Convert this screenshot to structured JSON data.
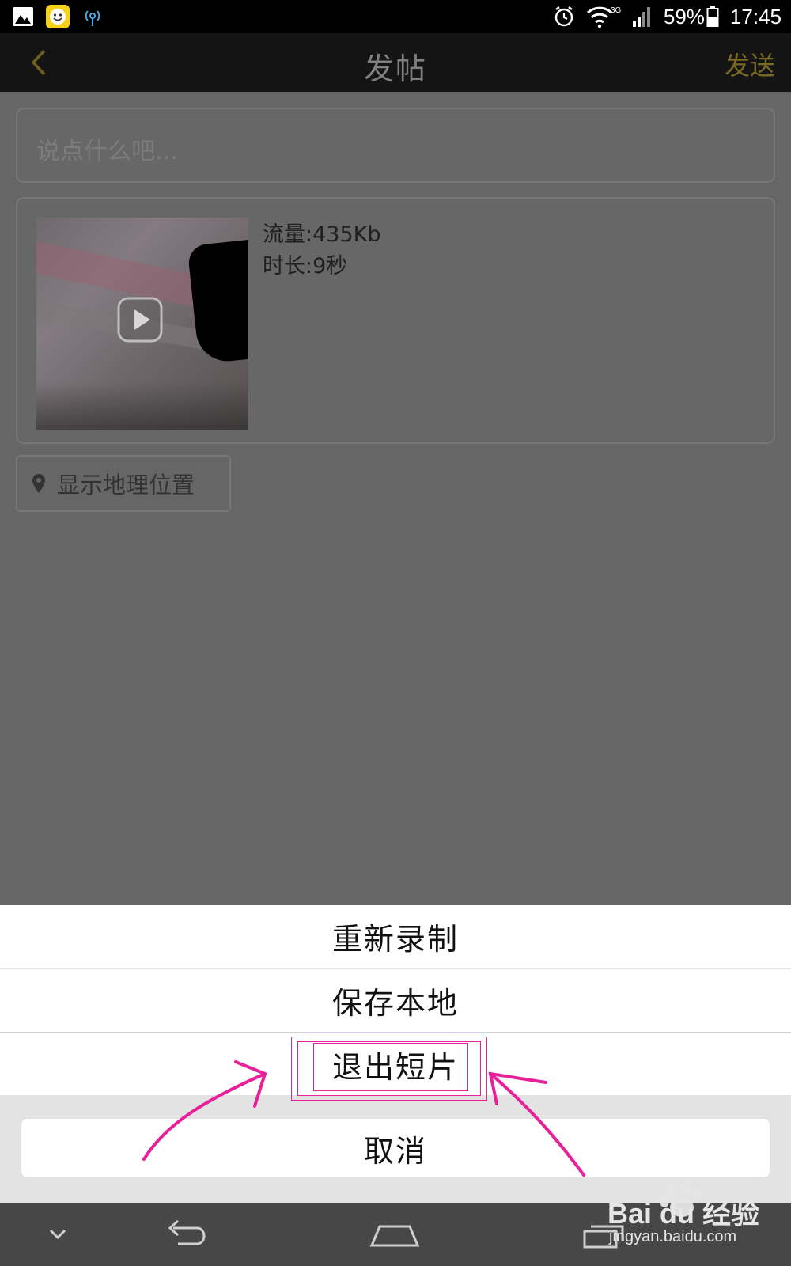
{
  "status_bar": {
    "battery": "59%",
    "time": "17:45",
    "network": "3G"
  },
  "header": {
    "title": "发帖",
    "send_label": "发送"
  },
  "composer": {
    "placeholder": "说点什么吧..."
  },
  "media": {
    "size": "流量:435Kb",
    "duration": "时长:9秒"
  },
  "location": {
    "label": "显示地理位置"
  },
  "action_sheet": {
    "items": [
      {
        "label": "重新录制"
      },
      {
        "label": "保存本地"
      },
      {
        "label": "退出短片"
      }
    ],
    "cancel_label": "取消"
  },
  "watermark": {
    "url": "jingyan.baidu.com",
    "brand": "Bai du 经验"
  },
  "colors": {
    "accent": "#d4b52a",
    "annotation": "#e8209a"
  }
}
